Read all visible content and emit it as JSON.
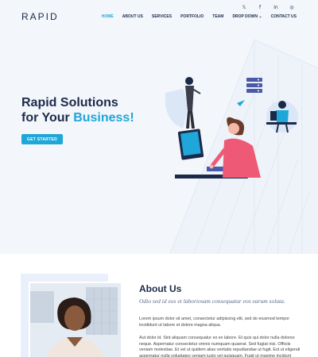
{
  "header": {
    "social": [
      "𝕏",
      "f",
      "in",
      "◎"
    ],
    "logo": "RAPID",
    "nav": [
      "HOME",
      "ABOUT US",
      "SERVICES",
      "PORTFOLIO",
      "TEAM",
      "DROP DOWN ⌄",
      "CONTACT US"
    ]
  },
  "hero": {
    "title_line1": "Rapid Solutions",
    "title_line2_prefix": "for Your ",
    "title_line2_accent": "Business!",
    "cta": "GET STARTED"
  },
  "about": {
    "title": "About Us",
    "subtitle": "Odio sed id eos et laboriosam consequatur eos earum soluta.",
    "p1": "Lorem ipsum dolor sit amet, consectetur adipiscing elit, sed do eiusmod tempor incididunt ut labore et dolore magna aliqua.",
    "p2": "Aut dolor id. Sint aliquam consequatur ex ex labore. Et quis qui dolor nulla dolores neque. Aspernatur consectetur omnis numquam quaerat. Sed fugiat nisi. Officiis veniam molestiae. Et vel ut quidem alias veritatis repudiandae ut fugit. Est ut eligendi aspernatur nulla voluptates veniam iusto vel quisquam. Fugit ut maxime incidunt"
  },
  "colors": {
    "accent": "#1ea7d8",
    "navy": "#1c2a4a",
    "pink": "#ee5a76"
  }
}
